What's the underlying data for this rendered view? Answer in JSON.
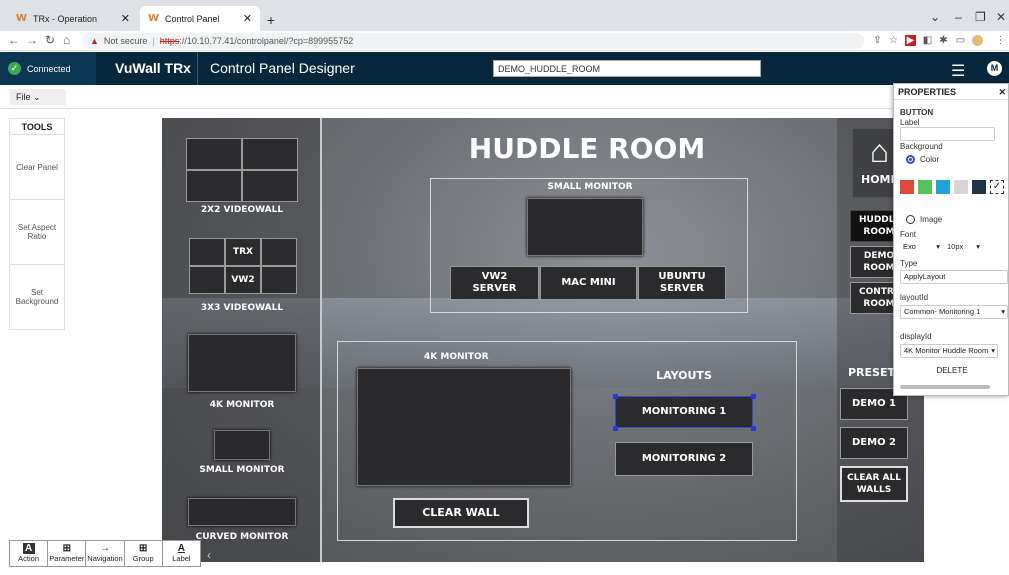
{
  "browser": {
    "tabs": [
      {
        "title": "TRx - Operation",
        "active": false
      },
      {
        "title": "Control Panel",
        "active": true
      }
    ],
    "url_warning": "Not secure",
    "url_scheme": "https",
    "url_rest": "://10.10.77.41/controlpanel/?cp=899955752"
  },
  "app": {
    "status": "Connected",
    "brand": "VuWall TRx",
    "title": "Control Panel Designer",
    "room_name": "DEMO_HUDDLE_ROOM",
    "avatar": "M",
    "file_menu": "File"
  },
  "tools": {
    "header": "TOOLS",
    "items": [
      "Clear Panel",
      "Set Aspect Ratio",
      "Set Background"
    ]
  },
  "canvas": {
    "title": "HUDDLE ROOM",
    "left_items": {
      "videowall_2x2": "2X2 VIDEOWALL",
      "videowall_3x3": "3X3 VIDEOWALL",
      "cell_trx": "TRX",
      "cell_vw2": "VW2",
      "monitor_4k": "4K MONITOR",
      "small_monitor": "SMALL MONITOR",
      "curved_monitor": "CURVED MONITOR"
    },
    "small_monitor_group": {
      "label": "SMALL MONITOR",
      "sources": [
        "VW2 SERVER",
        "MAC MINI",
        "UBUNTU SERVER"
      ]
    },
    "monitor_4k_group": {
      "label": "4K MONITOR",
      "layouts_label": "LAYOUTS",
      "layouts": [
        "MONITORING 1",
        "MONITORING 2"
      ],
      "clear_wall": "CLEAR WALL"
    },
    "right_nav": {
      "home": "HOME",
      "rooms": [
        "HUDDLE ROOM",
        "DEMO ROOM",
        "CONTROL ROOM"
      ],
      "presets_label": "PRESETS",
      "presets": [
        "DEMO 1",
        "DEMO 2",
        "CLEAR ALL WALLS"
      ]
    }
  },
  "properties": {
    "header": "PROPERTIES",
    "section": "BUTTON",
    "label_field": "Label",
    "label_value": "",
    "background": "Background",
    "color_option": "Color",
    "image_option": "Image",
    "swatches": [
      "#e0483c",
      "#56c25a",
      "#1fa3d8",
      "#d6d6d6",
      "#1f3448"
    ],
    "font_label": "Font",
    "font_family": "Exo",
    "font_size": "10px",
    "type_label": "Type",
    "type_value": "ApplyLayout",
    "layoutid_label": "layoutId",
    "layoutid_value": "Common- Monitoring 1",
    "displayid_label": "displayId",
    "displayid_value": "4K Monitor Huddle Room",
    "delete": "DELETE"
  },
  "bottom_tools": [
    "Action",
    "Parameter",
    "Navigation",
    "Group",
    "Label"
  ]
}
